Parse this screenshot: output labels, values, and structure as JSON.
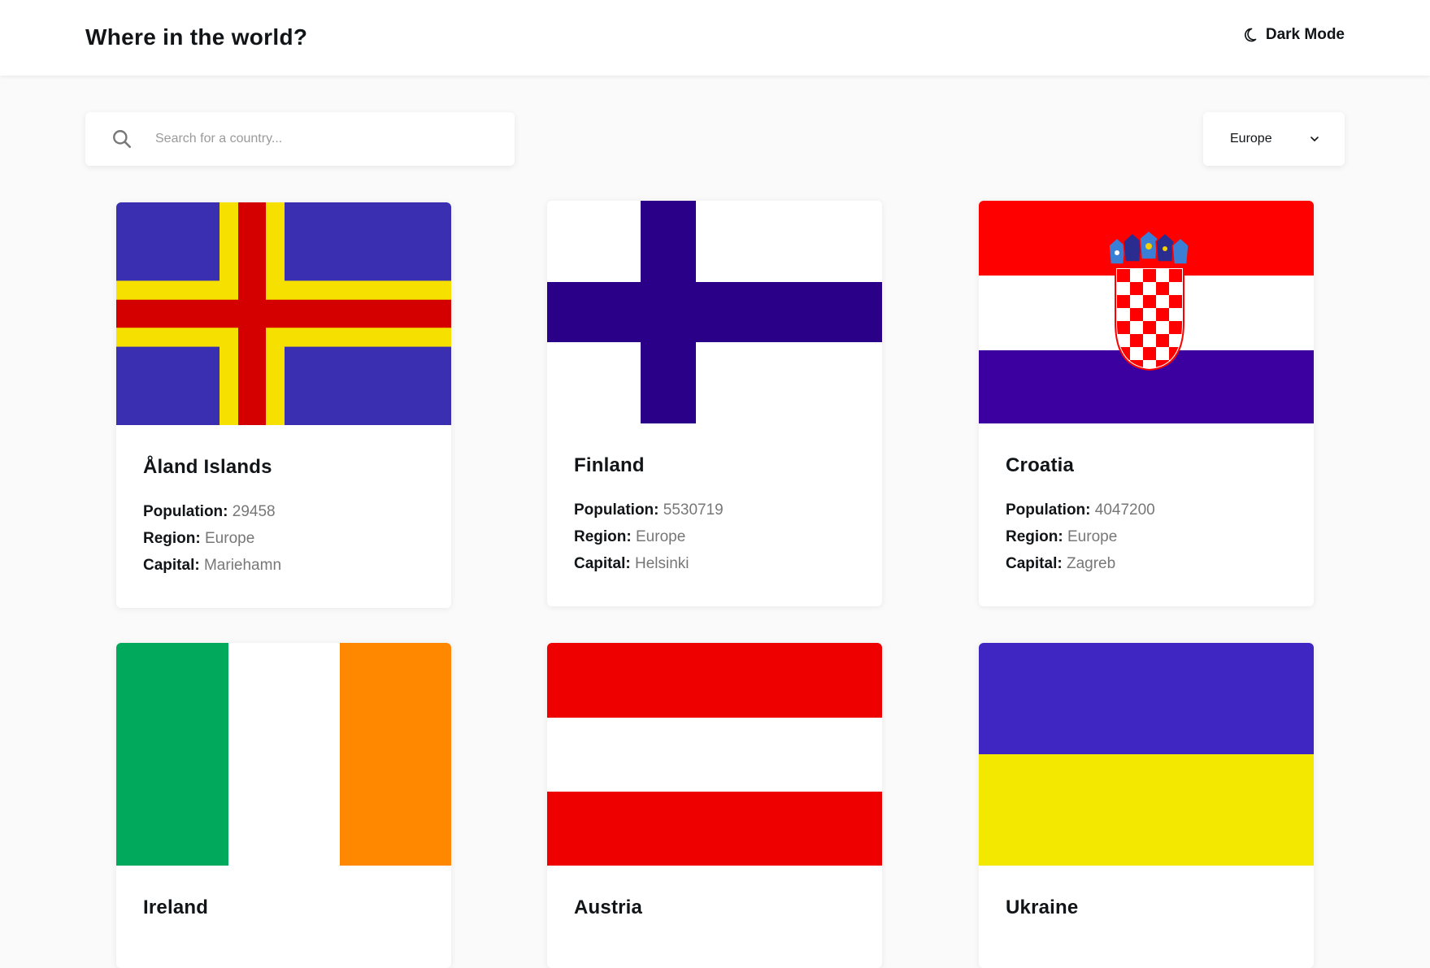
{
  "header": {
    "title": "Where in the world?",
    "theme_toggle_label": "Dark Mode"
  },
  "search": {
    "placeholder": "Search for a country..."
  },
  "filter": {
    "selected": "Europe"
  },
  "labels": {
    "population": "Population:",
    "region": "Region:",
    "capital": "Capital:"
  },
  "countries": [
    {
      "name": "Åland Islands",
      "population": "29458",
      "region": "Europe",
      "capital": "Mariehamn"
    },
    {
      "name": "Finland",
      "population": "5530719",
      "region": "Europe",
      "capital": "Helsinki"
    },
    {
      "name": "Croatia",
      "population": "4047200",
      "region": "Europe",
      "capital": "Zagreb"
    },
    {
      "name": "Ireland",
      "population": "",
      "region": "",
      "capital": ""
    },
    {
      "name": "Austria",
      "population": "",
      "region": "",
      "capital": ""
    },
    {
      "name": "Ukraine",
      "population": "",
      "region": "",
      "capital": ""
    }
  ],
  "colors": {
    "aland_blue": "#3a2fb0",
    "aland_yellow": "#f5e000",
    "aland_red": "#d40000",
    "finland_blue": "#2a0088",
    "croatia_red": "#ff0000",
    "croatia_blue": "#3d00a0",
    "ireland_green": "#00a95c",
    "ireland_orange": "#ff8800",
    "austria_red": "#ee0000",
    "ukraine_blue": "#3f26c3",
    "ukraine_yellow": "#f3e800"
  }
}
